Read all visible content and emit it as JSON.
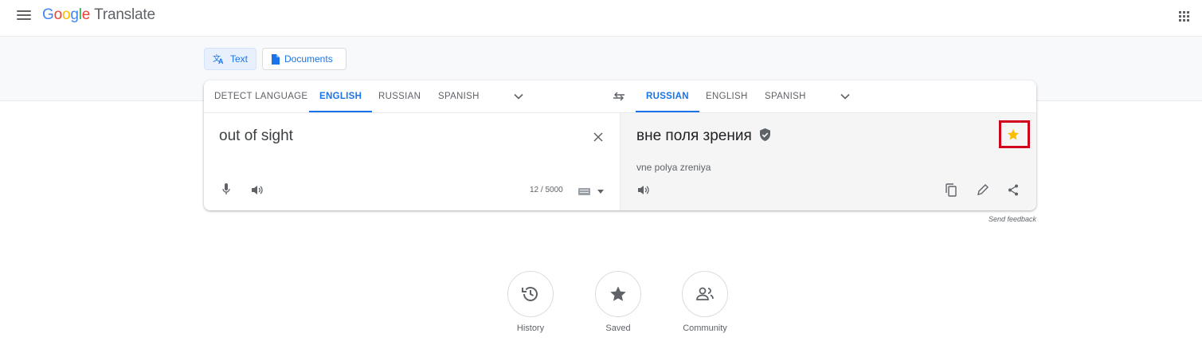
{
  "header": {
    "logo_text": "Google",
    "product_name": "Translate",
    "icons": [
      "menu-icon",
      "apps-grid-icon"
    ]
  },
  "modes": [
    {
      "label": "Text",
      "icon": "translate-icon",
      "active": true
    },
    {
      "label": "Documents",
      "icon": "document-icon",
      "active": false
    }
  ],
  "source_languages": [
    "DETECT LANGUAGE",
    "ENGLISH",
    "RUSSIAN",
    "SPANISH"
  ],
  "source_selected": "ENGLISH",
  "target_languages": [
    "RUSSIAN",
    "ENGLISH",
    "SPANISH"
  ],
  "target_selected": "RUSSIAN",
  "source": {
    "text": "out of sight",
    "char_count": "12 / 5000"
  },
  "target": {
    "text": "вне поля зрения",
    "transliteration": "vne polya zreniya"
  },
  "send_feedback": "Send feedback",
  "bottom_actions": [
    {
      "label": "History",
      "icon": "history-icon"
    },
    {
      "label": "Saved",
      "icon": "star-icon"
    },
    {
      "label": "Community",
      "icon": "community-icon"
    }
  ],
  "colors": {
    "accent": "#1a73e8",
    "star": "#fbbc04",
    "highlight_box": "#d0021b"
  }
}
